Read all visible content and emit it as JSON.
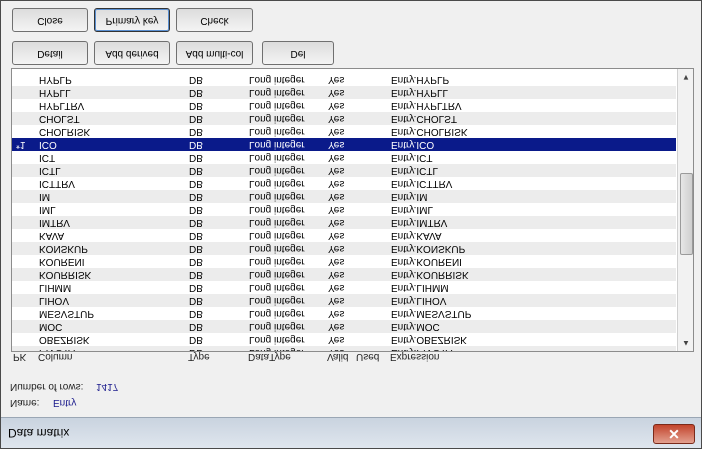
{
  "window": {
    "title": "Data matrix",
    "close_glyph": "✕"
  },
  "info": {
    "name_label": "Name:",
    "name_value": "Entry",
    "rows_label": "Number of rows:",
    "rows_value": "1417"
  },
  "columns": {
    "pk": "PK",
    "column": "Column",
    "type": "Type",
    "datatype": "DataType",
    "valid": "Valid",
    "used": "Used",
    "expression": "Expression"
  },
  "table": {
    "rows": [
      {
        "pk": "",
        "column": "HYPLP",
        "type": "DB",
        "datatype": "Long integer",
        "valid": "Yes",
        "expression": "Entry.HYPLP"
      },
      {
        "pk": "",
        "column": "HYPLL",
        "type": "DB",
        "datatype": "Long integer",
        "valid": "Yes",
        "expression": "Entry.HYPLL"
      },
      {
        "pk": "",
        "column": "HYPLTRV",
        "type": "DB",
        "datatype": "Long integer",
        "valid": "Yes",
        "expression": "Entry.HYPLTRV"
      },
      {
        "pk": "",
        "column": "CHOLST",
        "type": "DB",
        "datatype": "Long integer",
        "valid": "Yes",
        "expression": "Entry.CHOLST"
      },
      {
        "pk": "",
        "column": "CHOLRISK",
        "type": "DB",
        "datatype": "Long integer",
        "valid": "Yes",
        "expression": "Entry.CHOLRISK"
      },
      {
        "pk": "*1",
        "column": "ICO",
        "type": "DB",
        "datatype": "Long integer",
        "valid": "Yes",
        "expression": "Entry.ICO"
      },
      {
        "pk": "",
        "column": "ICT",
        "type": "DB",
        "datatype": "Long integer",
        "valid": "Yes",
        "expression": "Entry.ICT"
      },
      {
        "pk": "",
        "column": "ICTL",
        "type": "DB",
        "datatype": "Long integer",
        "valid": "Yes",
        "expression": "Entry.ICTL"
      },
      {
        "pk": "",
        "column": "ICTTRV",
        "type": "DB",
        "datatype": "Long integer",
        "valid": "Yes",
        "expression": "Entry.ICTTRV"
      },
      {
        "pk": "",
        "column": "IM",
        "type": "DB",
        "datatype": "Long integer",
        "valid": "Yes",
        "expression": "Entry.IM"
      },
      {
        "pk": "",
        "column": "IML",
        "type": "DB",
        "datatype": "Long integer",
        "valid": "Yes",
        "expression": "Entry.IML"
      },
      {
        "pk": "",
        "column": "IMTRV",
        "type": "DB",
        "datatype": "Long integer",
        "valid": "Yes",
        "expression": "Entry.IMTRV"
      },
      {
        "pk": "",
        "column": "KAVA",
        "type": "DB",
        "datatype": "Long integer",
        "valid": "Yes",
        "expression": "Entry.KAVA"
      },
      {
        "pk": "",
        "column": "KONSKUP",
        "type": "DB",
        "datatype": "Long integer",
        "valid": "Yes",
        "expression": "Entry.KONSKUP"
      },
      {
        "pk": "",
        "column": "KOURENI",
        "type": "DB",
        "datatype": "Long integer",
        "valid": "Yes",
        "expression": "Entry.KOURENI"
      },
      {
        "pk": "",
        "column": "KOURRISK",
        "type": "DB",
        "datatype": "Long integer",
        "valid": "Yes",
        "expression": "Entry.KOURRISK"
      },
      {
        "pk": "",
        "column": "LIHMM",
        "type": "DB",
        "datatype": "Long integer",
        "valid": "Yes",
        "expression": "Entry.LIHMM"
      },
      {
        "pk": "",
        "column": "LIHOV",
        "type": "DB",
        "datatype": "Long integer",
        "valid": "Yes",
        "expression": "Entry.LIHOV"
      },
      {
        "pk": "",
        "column": "MESVSTUP",
        "type": "DB",
        "datatype": "Long integer",
        "valid": "Yes",
        "expression": "Entry.MESVSTUP"
      },
      {
        "pk": "",
        "column": "MOC",
        "type": "DB",
        "datatype": "Long integer",
        "valid": "Yes",
        "expression": "Entry.MOC"
      },
      {
        "pk": "",
        "column": "OBEZRISK",
        "type": "DB",
        "datatype": "Long integer",
        "valid": "Yes",
        "expression": "Entry.OBEZRISK"
      },
      {
        "pk": "",
        "column": "PIVOTA",
        "type": "DB",
        "datatype": "Long integer",
        "valid": "Yes",
        "expression": "Entry.PIVOTA"
      }
    ],
    "selected_index": 5
  },
  "scrollbar": {
    "up_glyph": "▲",
    "down_glyph": "▼"
  },
  "buttons": {
    "del": "Del",
    "add_multi": "Add multi-col",
    "add_derived": "Add derived",
    "detail": "Detail",
    "check": "Check",
    "primary_key": "Primary key",
    "close": "Close"
  }
}
